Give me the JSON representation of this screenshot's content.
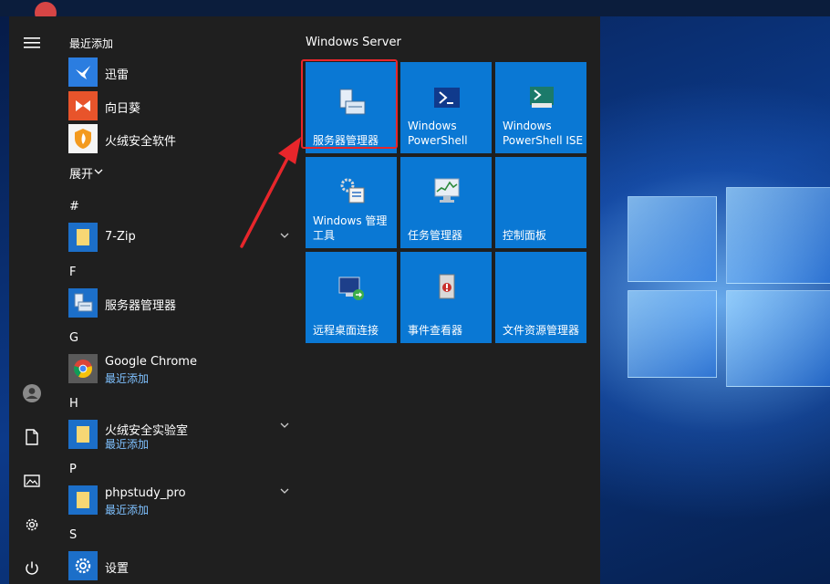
{
  "section_recent": "最近添加",
  "expand_label": "展开",
  "group_title": "Windows Server",
  "recent_apps": [
    {
      "name": "迅雷",
      "icon": "xunlei-bird-icon"
    },
    {
      "name": "向日葵",
      "icon": "sunflower-icon"
    },
    {
      "name": "火绒安全软件",
      "icon": "huorong-shield-icon"
    }
  ],
  "groups": [
    {
      "letter": "#",
      "apps": [
        {
          "name": "7-Zip",
          "sub": "",
          "expandable": true,
          "icon": "folder-icon"
        }
      ]
    },
    {
      "letter": "F",
      "apps": [
        {
          "name": "服务器管理器",
          "sub": "",
          "expandable": false,
          "icon": "server-manager-icon"
        }
      ]
    },
    {
      "letter": "G",
      "apps": [
        {
          "name": "Google Chrome",
          "sub": "最近添加",
          "expandable": false,
          "icon": "chrome-icon"
        }
      ]
    },
    {
      "letter": "H",
      "apps": [
        {
          "name": "火绒安全实验室",
          "sub": "最近添加",
          "expandable": true,
          "icon": "folder-icon"
        }
      ]
    },
    {
      "letter": "P",
      "apps": [
        {
          "name": "phpstudy_pro",
          "sub": "最近添加",
          "expandable": true,
          "icon": "folder-icon"
        }
      ]
    },
    {
      "letter": "S",
      "apps": [
        {
          "name": "设置",
          "sub": "",
          "expandable": false,
          "icon": "gear-icon"
        }
      ]
    }
  ],
  "tiles": [
    {
      "label_1": "",
      "label_2": "服务器管理器",
      "icon": "server-manager-icon"
    },
    {
      "label_1": "Windows",
      "label_2": "PowerShell",
      "icon": "powershell-icon"
    },
    {
      "label_1": "Windows",
      "label_2": "PowerShell ISE",
      "icon": "powershell-ise-icon"
    },
    {
      "label_1": "Windows 管理",
      "label_2": "工具",
      "icon": "admin-tools-icon"
    },
    {
      "label_1": "",
      "label_2": "任务管理器",
      "icon": "task-manager-icon"
    },
    {
      "label_1": "",
      "label_2": "控制面板",
      "icon": "control-panel-icon"
    },
    {
      "label_1": "",
      "label_2": "远程桌面连接",
      "icon": "remote-desktop-icon"
    },
    {
      "label_1": "",
      "label_2": "事件查看器",
      "icon": "event-viewer-icon"
    },
    {
      "label_1": "",
      "label_2": "文件资源管理器",
      "icon": "file-explorer-icon"
    }
  ],
  "colors": {
    "tile": "#0a78d4",
    "menu_bg": "#1f1f1f",
    "accent_sub": "#7fc1ff",
    "highlight": "#e8262b"
  }
}
